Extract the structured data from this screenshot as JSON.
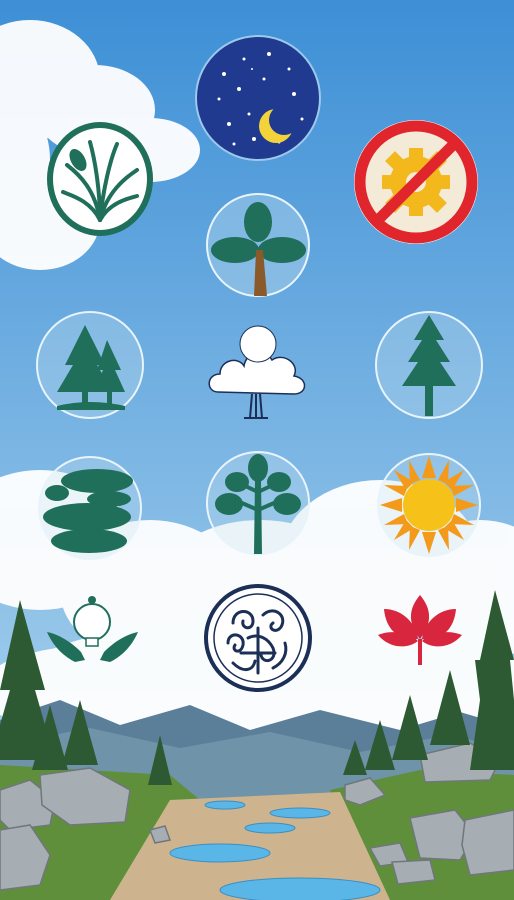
{
  "scene": {
    "sky_top": "#3d8fd6",
    "sky_bottom": "#a9d4ef",
    "mountain_color": "#5b7f99",
    "grass_color": "#5f8f3a",
    "path_color": "#cdb48e",
    "water_color": "#5ab6e6"
  },
  "colors": {
    "forest_green": "#1f6f5a",
    "trunk_brown": "#8a5a2b",
    "night_blue": "#1f3a8f",
    "moon_yellow": "#f4d23a",
    "prohibit_red": "#e0262c",
    "gear_yellow": "#f2b81c",
    "sun_orange": "#f39a1b",
    "leaf_red": "#d7263d",
    "navy_outline": "#1b2f57",
    "badge_ring": "#e8f4fb"
  },
  "icons": [
    {
      "name": "night-moon-icon",
      "shape": "night sky with crescent moon"
    },
    {
      "name": "plant-leaves-icon",
      "shape": "leafy plant in green circle"
    },
    {
      "name": "no-gear-icon",
      "shape": "gear with prohibition sign"
    },
    {
      "name": "tree-badge-icon",
      "shape": "three-leaf tree"
    },
    {
      "name": "pine-pair-icon",
      "shape": "two pine trees on ground"
    },
    {
      "name": "cloud-tree-icon",
      "shape": "cloud-shaped tree"
    },
    {
      "name": "single-pine-icon",
      "shape": "single pine tree"
    },
    {
      "name": "stone-stack-icon",
      "shape": "stacked stones"
    },
    {
      "name": "sapling-icon",
      "shape": "branching sapling"
    },
    {
      "name": "sun-icon",
      "shape": "sun"
    },
    {
      "name": "hands-light-icon",
      "shape": "hands holding light bulb"
    },
    {
      "name": "swirl-emblem-icon",
      "shape": "circular swirl emblem"
    },
    {
      "name": "red-leaf-icon",
      "shape": "red maple leaf"
    }
  ]
}
